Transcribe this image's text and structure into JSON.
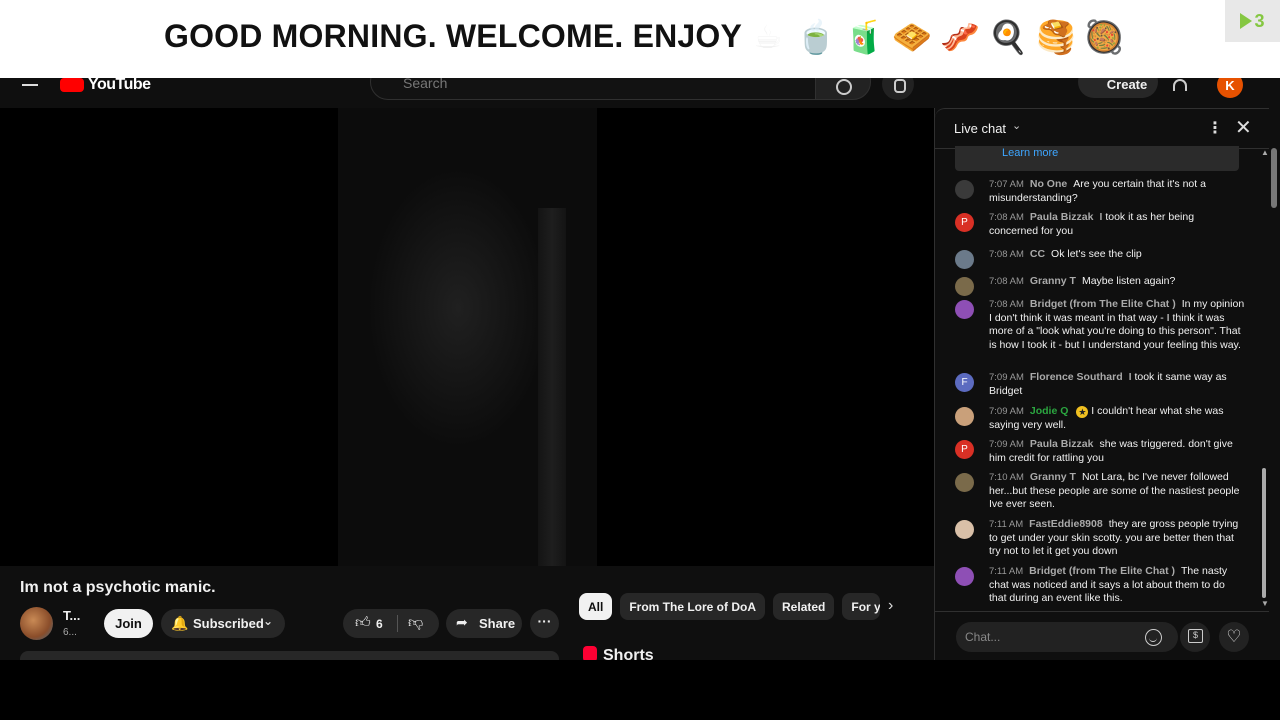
{
  "banner": {
    "text": "GOOD MORNING. WELCOME. ENJOY",
    "emojis": [
      "☕",
      "🍵",
      "🧃",
      "🧇",
      "🥓",
      "🍳",
      "🥞",
      "🥘"
    ],
    "badge_count": "3"
  },
  "header": {
    "logo_text": "YouTube",
    "search_placeholder": "Search",
    "create_label": "Create",
    "avatar_letter": "K"
  },
  "video": {
    "title": "Im not a psychotic manic.",
    "channel_name": "T...",
    "channel_subs": "6...",
    "join_label": "Join",
    "subscribed_label": "Subscribed",
    "like_count": "6",
    "share_label": "Share"
  },
  "chips": [
    "All",
    "From The Lore of DoA",
    "Related",
    "For you"
  ],
  "shorts_title": "Shorts",
  "chat": {
    "title": "Live chat",
    "learn_more": "Learn more",
    "input_placeholder": "Chat...",
    "messages": [
      {
        "time": "7:07 AM",
        "author": "No One",
        "text": "Are you certain that it's not a misunderstanding?",
        "avatar": "",
        "color": "#3a3a3a"
      },
      {
        "time": "7:08 AM",
        "author": "Paula Bizzak",
        "text": "I took it as her being concerned for you",
        "avatar": "P",
        "color": "#d93025"
      },
      {
        "time": "7:08 AM",
        "author": "CC",
        "text": "Ok let's see the clip",
        "avatar": "",
        "color": "#6b7a8a"
      },
      {
        "time": "7:08 AM",
        "author": "Granny T",
        "text": "Maybe listen again?",
        "avatar": "",
        "color": "#7a6a4a"
      },
      {
        "time": "7:08 AM",
        "author": "Bridget (from The Elite Chat )",
        "text": "In my opinion I don't think it was meant in that way - I think it was more of a \"look what you're doing to this person\". That is how I took it - but I understand your feeling this way.",
        "avatar": "",
        "color": "#8e4fb5"
      },
      {
        "time": "7:09 AM",
        "author": "Florence Southard",
        "text": "I took it same way as Bridget",
        "avatar": "F",
        "color": "#5c6bc0"
      },
      {
        "time": "7:09 AM",
        "author": "Jodie Q",
        "text": "I couldn't hear what she was saying very well.",
        "avatar": "",
        "color": "#c9a07a",
        "member": true
      },
      {
        "time": "7:09 AM",
        "author": "Paula Bizzak",
        "text": "she was triggered. don't give him credit for rattling you",
        "avatar": "P",
        "color": "#d93025"
      },
      {
        "time": "7:10 AM",
        "author": "Granny T",
        "text": "Not Lara, bc I've never followed her...but these people are some of the nastiest people Ive ever seen.",
        "avatar": "",
        "color": "#7a6a4a"
      },
      {
        "time": "7:11 AM",
        "author": "FastEddie8908",
        "text": "they are gross people trying to get under your skin scotty. you are better then that try not to let it get you down",
        "avatar": "",
        "color": "#d9c0a8"
      },
      {
        "time": "7:11 AM",
        "author": "Bridget (from The Elite Chat )",
        "text": "The nasty chat was noticed and it says a lot about them to do that during an event like this.",
        "avatar": "",
        "color": "#8e4fb5"
      }
    ]
  }
}
